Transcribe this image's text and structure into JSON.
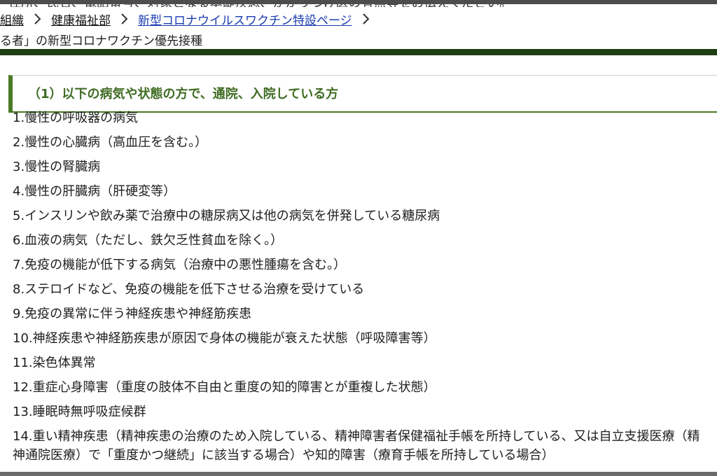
{
  "header": {
    "clipped_text": "住所、氏名、電話番号、対象となる基礎疾患、かかりつけ医の有無等をお伝えください。"
  },
  "breadcrumb": {
    "items": [
      {
        "label": "組織"
      },
      {
        "label": "健康福祉部"
      },
      {
        "label": "新型コロナウイルスワクチン特設ページ"
      }
    ]
  },
  "current_page": {
    "label": "る者」の新型コロナワクチン優先接種"
  },
  "section": {
    "heading": "（1）以下の病気や状態の方で、通院、入院している方"
  },
  "conditions": [
    "1.慢性の呼吸器の病気",
    "2.慢性の心臓病（高血圧を含む。）",
    "3.慢性の腎臓病",
    "4.慢性の肝臓病（肝硬変等）",
    "5.インスリンや飲み薬で治療中の糖尿病又は他の病気を併発している糖尿病",
    "6.血液の病気（ただし、鉄欠乏性貧血を除く。）",
    "7.免疫の機能が低下する病気（治療中の悪性腫瘍を含む。）",
    "8.ステロイドなど、免疫の機能を低下させる治療を受けている",
    "9.免疫の異常に伴う神経疾患や神経筋疾患",
    "10.神経疾患や神経筋疾患が原因で身体の機能が衰えた状態（呼吸障害等）",
    "11.染色体異常",
    "12.重症心身障害（重度の肢体不自由と重度の知的障害とが重複した状態）",
    "13.睡眠時無呼吸症候群",
    "14.重い精神疾患（精神疾患の治療のため入院している、精神障害者保健福祉手帳を所持している、又は自立支援医療（精神通院医療）で「重度かつ継続」に該当する場合）や知的障害（療育手帳を所持している場合）"
  ],
  "colors": {
    "accent_green": "#4a7a26",
    "heading_text": "#3f6b22",
    "band": "#1f3d12",
    "link_visited": "#1a3cb0"
  },
  "icons": {
    "breadcrumb_separator": "chevron-right-icon"
  }
}
